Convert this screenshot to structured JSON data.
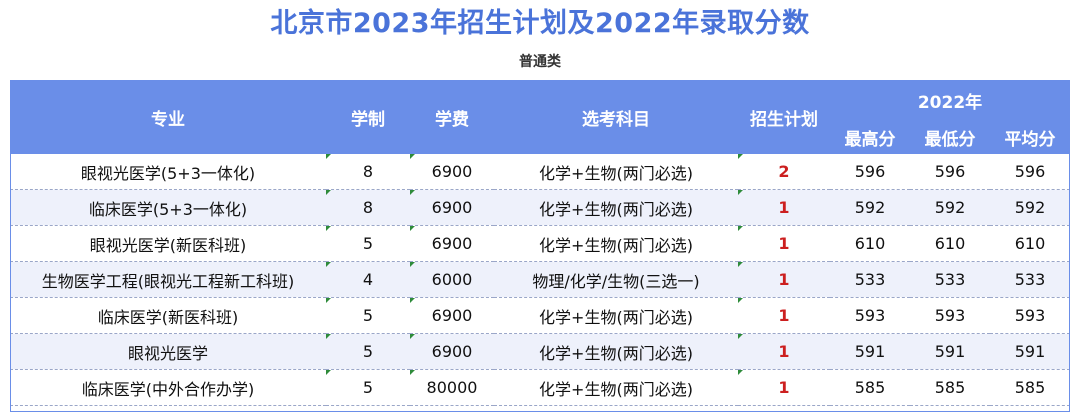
{
  "title": "北京市2023年招生计划及2022年录取分数",
  "subtitle": "普通类",
  "headers": {
    "major": "专业",
    "duration": "学制",
    "fee": "学费",
    "subjects": "选考科目",
    "plan": "招生计划",
    "year_group": "2022年",
    "max": "最高分",
    "min": "最低分",
    "avg": "平均分"
  },
  "rows": [
    {
      "major": "眼视光医学(5+3一体化)",
      "duration": "8",
      "fee": "6900",
      "subjects": "化学+生物(两门必选)",
      "plan": "2",
      "max": "596",
      "min": "596",
      "avg": "596"
    },
    {
      "major": "临床医学(5+3一体化)",
      "duration": "8",
      "fee": "6900",
      "subjects": "化学+生物(两门必选)",
      "plan": "1",
      "max": "592",
      "min": "592",
      "avg": "592"
    },
    {
      "major": "眼视光医学(新医科班)",
      "duration": "5",
      "fee": "6900",
      "subjects": "化学+生物(两门必选)",
      "plan": "1",
      "max": "610",
      "min": "610",
      "avg": "610"
    },
    {
      "major": "生物医学工程(眼视光工程新工科班)",
      "duration": "4",
      "fee": "6000",
      "subjects": "物理/化学/生物(三选一)",
      "plan": "1",
      "max": "533",
      "min": "533",
      "avg": "533"
    },
    {
      "major": "临床医学(新医科班)",
      "duration": "5",
      "fee": "6900",
      "subjects": "化学+生物(两门必选)",
      "plan": "1",
      "max": "593",
      "min": "593",
      "avg": "593"
    },
    {
      "major": "眼视光医学",
      "duration": "5",
      "fee": "6900",
      "subjects": "化学+生物(两门必选)",
      "plan": "1",
      "max": "591",
      "min": "591",
      "avg": "591"
    },
    {
      "major": "临床医学(中外合作办学)",
      "duration": "5",
      "fee": "80000",
      "subjects": "化学+生物(两门必选)",
      "plan": "1",
      "max": "585",
      "min": "585",
      "avg": "585"
    }
  ],
  "colors": {
    "title": "#4a73d9",
    "header_bg": "#6a8ee8",
    "row_alt_bg": "#eef1fb",
    "plan_text": "#cc1f1f",
    "cell_marker": "#2e8b3a"
  }
}
